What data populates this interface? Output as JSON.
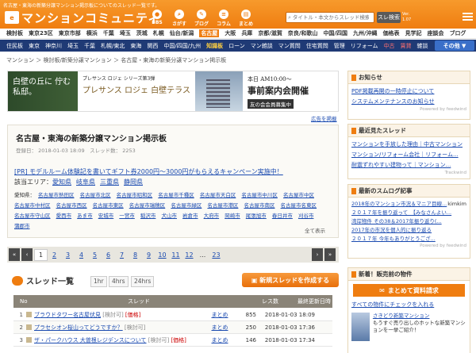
{
  "header": {
    "tagline": "名古屋・東海の新築分譲マンション掲示板についてのスレッド一覧です。",
    "logo_mark": "e",
    "logo_text": "マンションコミュニティ",
    "icons": [
      {
        "label": "BBS",
        "icon": "chat-icon"
      },
      {
        "label": "さがす",
        "icon": "search-icon"
      },
      {
        "label": "ブログ",
        "icon": "blog-icon"
      },
      {
        "label": "コラム",
        "icon": "column-icon"
      },
      {
        "label": "まとめ",
        "icon": "matome-icon"
      }
    ],
    "search_placeholder": "タイトル・本文からスレッド検索",
    "search_button": "スレ検索",
    "version": "Ver. 1.07"
  },
  "area_nav": [
    "検討板",
    "東京23区",
    "東京市部",
    "横浜",
    "千葉",
    "埼玉",
    "茨城",
    "札幌",
    "仙台/新潟",
    "名古屋",
    "大阪",
    "兵庫",
    "京都/滋賀",
    "奈良/和歌山",
    "中国/四国",
    "九州/沖縄",
    "価格表",
    "見学記",
    "座談会",
    "ブログ"
  ],
  "area_active": "名古屋",
  "cat_nav": [
    "住民板",
    "東京",
    "神奈川",
    "埼玉",
    "千葉",
    "札幌/東北",
    "東海",
    "関西",
    "中国/四国/九州",
    "知識板",
    "ローン",
    "マン雑談",
    "マン質問",
    "住宅質問",
    "管理",
    "リフォーム",
    "中古",
    "賃貸",
    "雑談"
  ],
  "cat_other": "その他 ▼",
  "breadcrumb": [
    "マンション",
    "検討板/新築分譲マンション",
    "名古屋・東海の新築分譲マンション掲示板"
  ],
  "banner": {
    "left": "白壁の丘に 佇む私邸。",
    "sub": "プレサンス ロジェ シリーズ第3弾",
    "name": "プレサンス ロジェ 白壁テラス",
    "date": "本日 AM10:00～",
    "cta": "事前案内会開催",
    "note": "友の会会員募集中"
  },
  "ad_link": "広告を掲載",
  "board": {
    "title": "名古屋・東海の新築分譲マンション掲示板",
    "created": "登録日： 2018-01-03 18:09",
    "thread_count": "スレッド数： 2253",
    "pr": "[PR] モデルルーム体験記を書いてギフト券2000円～3000円がもらえるキャンペーン実施中！",
    "area_label": "該当エリア：",
    "areas": [
      "愛知県",
      "岐阜県",
      "三重県",
      "静岡県"
    ],
    "cities_label": "愛知県：",
    "cities": [
      "名古屋市熱田区",
      "名古屋市北区",
      "名古屋市昭和区",
      "名古屋市千種区",
      "名古屋市天白区",
      "名古屋市中川区",
      "名古屋市中区",
      "名古屋市中村区",
      "名古屋市西区",
      "名古屋市東区",
      "名古屋市瑞穂区",
      "名古屋市緑区",
      "名古屋市港区",
      "名古屋市南区",
      "名古屋市名東区",
      "名古屋市守山区",
      "愛西市",
      "あま市",
      "安城市",
      "一宮市",
      "稲沢市",
      "犬山市",
      "岩倉市",
      "大府市",
      "岡崎市",
      "尾張旭市",
      "春日井市",
      "刈谷市",
      "蒲郡市"
    ],
    "show_all": "全て表示"
  },
  "pager": {
    "pages": [
      "1",
      "2",
      "3",
      "4",
      "5",
      "6",
      "7",
      "8",
      "9",
      "10",
      "11",
      "12",
      "...",
      "23"
    ],
    "current": "1"
  },
  "thread_list": {
    "title": "スレッド一覧",
    "sorts": [
      "1hr",
      "4hrs",
      "24hrs"
    ],
    "new_button": "新規スレッドを作成する",
    "headers": [
      "No",
      "スレッド",
      "レス数",
      "最終更新日時"
    ],
    "rows": [
      {
        "no": "1",
        "title": "ブラウドタワー名古屋伏見",
        "tag1": "[検討可]",
        "tag2": "[価格]",
        "matome": "まとめ",
        "res": "855",
        "date": "2018-01-03 18:09"
      },
      {
        "no": "2",
        "title": "プラセシオン桜山ってどうですか？",
        "tag1": "[検討可]",
        "tag2": "",
        "matome": "まとめ",
        "res": "250",
        "date": "2018-01-03 17:36"
      },
      {
        "no": "3",
        "title": "ザ・パークハウス 大曽根レジデンスについて",
        "tag1": "[検討可]",
        "tag2": "[価格]",
        "matome": "まとめ",
        "res": "146",
        "date": "2018-01-03 17:34"
      }
    ]
  },
  "sidebar": {
    "notice": {
      "title": "お知らせ",
      "items": [
        "PDF掲載再開の一時停止について",
        "システムメンテナンスのお知らせ"
      ],
      "powered": "Powered by feedwind"
    },
    "recent": {
      "title": "最近見たスレッド",
      "items": [
        "マンションを手放した理由｜中古マンション",
        "マンション/リフォーム会社｜リフォーム...",
        "耐震ずれやすい建物って｜マンション..."
      ],
      "powered": "Trackwind"
    },
    "sumlog": {
      "title": "最新のスムログ記事",
      "items": [
        {
          "t": "2018年のマンション市況＆マニア目線...",
          "a": "kimkim"
        },
        {
          "t": "２０１７年を振り返って　【みなさんよい...",
          "a": ""
        },
        {
          "t": "湾岸物件 その38＆2017年振り返り(...",
          "a": ""
        },
        {
          "t": "2017年の市況を個人的に振り返る",
          "a": ""
        },
        {
          "t": "２０１７年 今年もありがとうござ...",
          "a": ""
        }
      ],
      "powered": "Powered by feedwind"
    },
    "sale": {
      "title": "新着！販売前の物件",
      "matome": "まとめて資料請求",
      "check_all": "すべての物件にチェックを入れる",
      "promo_title": "さきどり新築マンション",
      "promo_text": "もうすぐ売り出しのホットな新築マンションを一挙ご紹介！"
    }
  }
}
